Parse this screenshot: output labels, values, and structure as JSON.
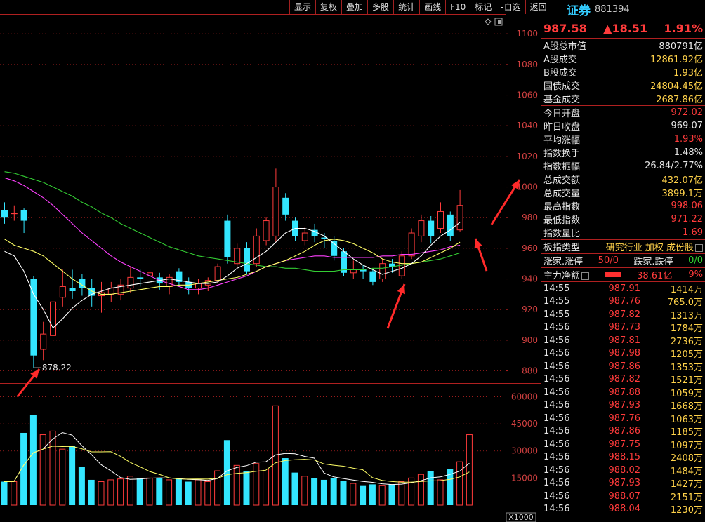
{
  "toolbar": [
    "显示",
    "复权",
    "叠加",
    "多股",
    "统计",
    "画线",
    "F10",
    "标记",
    "-自选",
    "返回"
  ],
  "stock": {
    "name": "证券",
    "code": "881394",
    "price": "987.58",
    "change": "▲18.51",
    "pct": "1.91%"
  },
  "market": [
    {
      "label": "A股总市值",
      "value": "880791亿",
      "cls": "vw"
    },
    {
      "label": "A股成交",
      "value": "12861.92亿",
      "cls": "v"
    },
    {
      "label": "B股成交",
      "value": "1.93亿",
      "cls": "v"
    },
    {
      "label": "国债成交",
      "value": "24804.45亿",
      "cls": "v"
    },
    {
      "label": "基金成交",
      "value": "2687.86亿",
      "cls": "v"
    }
  ],
  "stats": [
    {
      "label": "今日开盘",
      "value": "972.02",
      "cls": "vr"
    },
    {
      "label": "昨日收盘",
      "value": "969.07",
      "cls": "vw"
    },
    {
      "label": "平均涨幅",
      "value": "1.93%",
      "cls": "vr"
    },
    {
      "label": "指数换手",
      "value": "1.48%",
      "cls": "vw"
    },
    {
      "label": "指数振幅",
      "value": "26.84/2.77%",
      "cls": "vw"
    },
    {
      "label": "总成交额",
      "value": "432.07亿",
      "cls": "v"
    },
    {
      "label": "总成交量",
      "value": "3899.1万",
      "cls": "v"
    },
    {
      "label": "最高指数",
      "value": "998.06",
      "cls": "vr"
    },
    {
      "label": "最低指数",
      "value": "971.22",
      "cls": "vr"
    },
    {
      "label": "指数量比",
      "value": "1.69",
      "cls": "vr"
    }
  ],
  "board": {
    "label": "板指类型",
    "value": "研究行业 加权 成份股"
  },
  "updown": {
    "label": "涨家.涨停",
    "value": "50/0",
    "label2": "跌家.跌停",
    "value2": "0/0"
  },
  "flow": {
    "label": "主力净额",
    "value": "38.61亿",
    "pct": "9%"
  },
  "trades": [
    {
      "t": "14:55",
      "p": "987.91",
      "q": "1414万"
    },
    {
      "t": "14:55",
      "p": "987.76",
      "q": "765.0万"
    },
    {
      "t": "14:55",
      "p": "987.82",
      "q": "1313万"
    },
    {
      "t": "14:56",
      "p": "987.73",
      "q": "1784万"
    },
    {
      "t": "14:56",
      "p": "987.81",
      "q": "2736万"
    },
    {
      "t": "14:56",
      "p": "987.98",
      "q": "1205万"
    },
    {
      "t": "14:56",
      "p": "987.86",
      "q": "1353万"
    },
    {
      "t": "14:56",
      "p": "987.82",
      "q": "1521万"
    },
    {
      "t": "14:56",
      "p": "987.88",
      "q": "1059万"
    },
    {
      "t": "14:56",
      "p": "987.93",
      "q": "1668万"
    },
    {
      "t": "14:56",
      "p": "987.76",
      "q": "1063万"
    },
    {
      "t": "14:56",
      "p": "987.86",
      "q": "1185万"
    },
    {
      "t": "14:56",
      "p": "987.75",
      "q": "1097万"
    },
    {
      "t": "14:56",
      "p": "988.15",
      "q": "2408万"
    },
    {
      "t": "14:56",
      "p": "988.02",
      "q": "1484万"
    },
    {
      "t": "14:56",
      "p": "987.93",
      "q": "1427万"
    },
    {
      "t": "14:56",
      "p": "988.07",
      "q": "2151万"
    },
    {
      "t": "14:56",
      "p": "988.04",
      "q": "1230万"
    }
  ],
  "colors": {
    "up": "#ff3b3b",
    "down": "#33e6ff",
    "ma5": "#ffffff",
    "ma10": "#ffff66",
    "ma20": "#ff40ff",
    "ma60": "#33cc33",
    "grid": "#b02020"
  },
  "chart_data": {
    "type": "candlestick",
    "price_ticks": [
      1100,
      1080,
      1060,
      1040,
      1020,
      1000,
      980,
      960,
      940,
      920,
      900,
      880
    ],
    "price_range": [
      872,
      1112
    ],
    "volume_ticks": [
      "60000",
      "45000",
      "30000",
      "15000"
    ],
    "volume_range": [
      0,
      66000
    ],
    "volume_unit": "X1000",
    "low_label": "878.22",
    "candles": [
      {
        "o": 985,
        "c": 980,
        "h": 990,
        "l": 976
      },
      {
        "o": 983,
        "c": 983,
        "h": 988,
        "l": 978
      },
      {
        "o": 985,
        "c": 978,
        "h": 986,
        "l": 970
      },
      {
        "o": 940,
        "c": 890,
        "h": 942,
        "l": 882
      },
      {
        "o": 894,
        "c": 904,
        "h": 912,
        "l": 887
      },
      {
        "o": 903,
        "c": 925,
        "h": 928,
        "l": 883
      },
      {
        "o": 928,
        "c": 935,
        "h": 946,
        "l": 922
      },
      {
        "o": 934,
        "c": 932,
        "h": 946,
        "l": 927
      },
      {
        "o": 940,
        "c": 934,
        "h": 943,
        "l": 929
      },
      {
        "o": 934,
        "c": 929,
        "h": 940,
        "l": 922
      },
      {
        "o": 929,
        "c": 931,
        "h": 938,
        "l": 918
      },
      {
        "o": 930,
        "c": 934,
        "h": 938,
        "l": 925
      },
      {
        "o": 930,
        "c": 936,
        "h": 940,
        "l": 926
      },
      {
        "o": 934,
        "c": 941,
        "h": 948,
        "l": 931
      },
      {
        "o": 941,
        "c": 940,
        "h": 946,
        "l": 935
      },
      {
        "o": 942,
        "c": 944,
        "h": 947,
        "l": 938
      },
      {
        "o": 941,
        "c": 937,
        "h": 944,
        "l": 933
      },
      {
        "o": 935,
        "c": 941,
        "h": 943,
        "l": 930
      },
      {
        "o": 945,
        "c": 938,
        "h": 947,
        "l": 935
      },
      {
        "o": 938,
        "c": 934,
        "h": 941,
        "l": 930
      },
      {
        "o": 934,
        "c": 937,
        "h": 940,
        "l": 930
      },
      {
        "o": 936,
        "c": 939,
        "h": 941,
        "l": 932
      },
      {
        "o": 939,
        "c": 948,
        "h": 950,
        "l": 937
      },
      {
        "o": 978,
        "c": 954,
        "h": 982,
        "l": 950
      },
      {
        "o": 950,
        "c": 960,
        "h": 963,
        "l": 948
      },
      {
        "o": 960,
        "c": 945,
        "h": 964,
        "l": 943
      },
      {
        "o": 950,
        "c": 968,
        "h": 973,
        "l": 948
      },
      {
        "o": 965,
        "c": 978,
        "h": 980,
        "l": 962
      },
      {
        "o": 968,
        "c": 1000,
        "h": 1012,
        "l": 964
      },
      {
        "o": 993,
        "c": 982,
        "h": 996,
        "l": 978
      },
      {
        "o": 978,
        "c": 968,
        "h": 980,
        "l": 965
      },
      {
        "o": 965,
        "c": 970,
        "h": 974,
        "l": 962
      },
      {
        "o": 972,
        "c": 968,
        "h": 976,
        "l": 964
      },
      {
        "o": 967,
        "c": 966,
        "h": 970,
        "l": 960
      },
      {
        "o": 965,
        "c": 955,
        "h": 968,
        "l": 952
      },
      {
        "o": 958,
        "c": 944,
        "h": 960,
        "l": 942
      },
      {
        "o": 944,
        "c": 946,
        "h": 952,
        "l": 940
      },
      {
        "o": 946,
        "c": 945,
        "h": 949,
        "l": 940
      },
      {
        "o": 945,
        "c": 938,
        "h": 946,
        "l": 936
      },
      {
        "o": 940,
        "c": 950,
        "h": 953,
        "l": 938
      },
      {
        "o": 950,
        "c": 948,
        "h": 953,
        "l": 944
      },
      {
        "o": 942,
        "c": 955,
        "h": 958,
        "l": 940
      },
      {
        "o": 955,
        "c": 970,
        "h": 973,
        "l": 953
      },
      {
        "o": 968,
        "c": 978,
        "h": 982,
        "l": 964
      },
      {
        "o": 978,
        "c": 968,
        "h": 981,
        "l": 963
      },
      {
        "o": 973,
        "c": 984,
        "h": 990,
        "l": 970
      },
      {
        "o": 982,
        "c": 968,
        "h": 984,
        "l": 965
      },
      {
        "o": 972,
        "c": 988,
        "h": 998,
        "l": 971
      }
    ],
    "volume": [
      13000,
      13000,
      40000,
      50000,
      39000,
      41000,
      31000,
      33000,
      21000,
      14000,
      13000,
      14000,
      14500,
      16000,
      15000,
      15000,
      15000,
      14000,
      14500,
      13000,
      14000,
      13000,
      19000,
      36000,
      22000,
      19000,
      23000,
      20000,
      55000,
      26000,
      18000,
      16000,
      15000,
      14000,
      15000,
      13500,
      12000,
      11000,
      11500,
      11000,
      11500,
      13000,
      15000,
      17000,
      19000,
      14000,
      20000,
      24000,
      39000
    ],
    "ma5": [
      958,
      955,
      945,
      930,
      920,
      908,
      914,
      921,
      926,
      930,
      932,
      934,
      935,
      936,
      937,
      938,
      939,
      940,
      939,
      938,
      937,
      937,
      938,
      942,
      947,
      950,
      954,
      958,
      964,
      970,
      973,
      973,
      971,
      968,
      963,
      958,
      953,
      949,
      946,
      943,
      945,
      947,
      950,
      955,
      962,
      968,
      972,
      977
    ],
    "ma10": [
      966,
      962,
      960,
      958,
      955,
      950,
      945,
      940,
      936,
      932,
      930,
      930,
      931,
      932,
      933,
      934,
      935,
      935,
      936,
      936,
      937,
      938,
      939,
      940,
      941,
      943,
      945,
      948,
      950,
      952,
      955,
      958,
      962,
      965,
      966,
      965,
      963,
      960,
      957,
      953,
      951,
      950,
      950,
      951,
      954,
      957,
      960,
      964
    ],
    "ma20": [
      1006,
      1004,
      1001,
      997,
      993,
      988,
      982,
      976,
      970,
      965,
      960,
      955,
      951,
      948,
      945,
      942,
      939,
      937,
      935,
      933,
      933,
      934,
      936,
      938,
      940,
      942,
      945,
      948,
      950,
      952,
      953,
      954,
      955,
      955,
      954,
      954,
      954,
      954,
      954,
      955,
      955,
      956,
      956,
      957,
      958,
      959,
      961,
      962
    ],
    "ma60": [
      1010,
      1009,
      1007,
      1005,
      1003,
      1000,
      997,
      994,
      990,
      987,
      983,
      980,
      976,
      973,
      970,
      967,
      964,
      961,
      959,
      957,
      955,
      954,
      953,
      952,
      951,
      950,
      949,
      948,
      948,
      947,
      947,
      946,
      945,
      945,
      945,
      946,
      946,
      946,
      947,
      947,
      948,
      949,
      950,
      951,
      952,
      953,
      955,
      957
    ]
  }
}
